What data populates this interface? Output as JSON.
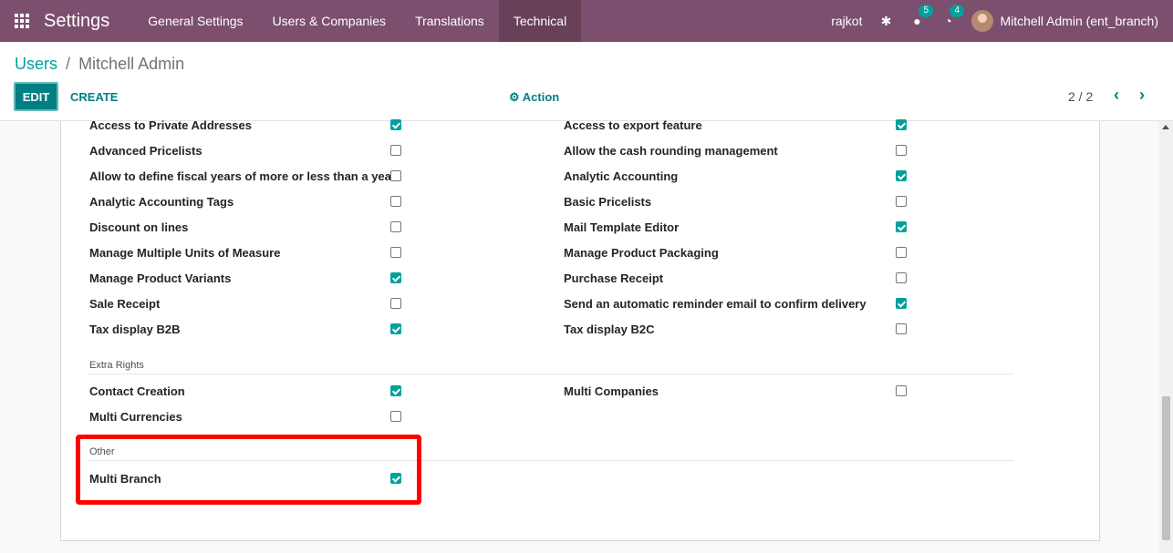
{
  "navbar": {
    "brand": "Settings",
    "menu": [
      "General Settings",
      "Users & Companies",
      "Translations",
      "Technical"
    ],
    "company": "rajkot",
    "messages_count": "5",
    "activities_count": "4",
    "user": "Mitchell Admin (ent_branch)"
  },
  "breadcrumb": {
    "parent": "Users",
    "separator": "/",
    "current": "Mitchell Admin"
  },
  "toolbar": {
    "edit": "EDIT",
    "create": "CREATE",
    "action": "Action",
    "action_icon": "⚙",
    "pager": "2 / 2"
  },
  "technical_left": [
    {
      "label": "Access to Private Addresses",
      "checked": true
    },
    {
      "label": "Advanced Pricelists",
      "checked": false
    },
    {
      "label": "Allow to define fiscal years of more or less than a year",
      "checked": false
    },
    {
      "label": "Analytic Accounting Tags",
      "checked": false
    },
    {
      "label": "Discount on lines",
      "checked": false
    },
    {
      "label": "Manage Multiple Units of Measure",
      "checked": false
    },
    {
      "label": "Manage Product Variants",
      "checked": true
    },
    {
      "label": "Sale Receipt",
      "checked": false
    },
    {
      "label": "Tax display B2B",
      "checked": true
    }
  ],
  "technical_right": [
    {
      "label": "Access to export feature",
      "checked": true
    },
    {
      "label": "Allow the cash rounding management",
      "checked": false
    },
    {
      "label": "Analytic Accounting",
      "checked": true
    },
    {
      "label": "Basic Pricelists",
      "checked": false
    },
    {
      "label": "Mail Template Editor",
      "checked": true
    },
    {
      "label": "Manage Product Packaging",
      "checked": false
    },
    {
      "label": "Purchase Receipt",
      "checked": false
    },
    {
      "label": "Send an automatic reminder email to confirm delivery",
      "checked": true
    },
    {
      "label": "Tax display B2C",
      "checked": false
    }
  ],
  "extra_rights": {
    "title": "Extra Rights",
    "left": [
      {
        "label": "Contact Creation",
        "checked": true
      },
      {
        "label": "Multi Currencies",
        "checked": false
      }
    ],
    "right": [
      {
        "label": "Multi Companies",
        "checked": false
      }
    ]
  },
  "other": {
    "title": "Other",
    "items": [
      {
        "label": "Multi Branch",
        "checked": true
      }
    ]
  },
  "colors": {
    "navbar": "#7c4f6e",
    "accent": "#00a09d",
    "highlight": "#ff0000"
  }
}
